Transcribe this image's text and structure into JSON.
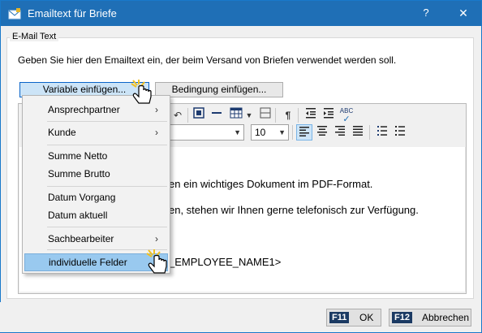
{
  "window": {
    "title": "Emailtext für Briefe",
    "help_symbol": "?",
    "close_symbol": "✕",
    "app_icon": "letter-envelope-icon"
  },
  "group": {
    "label": "E-Mail Text",
    "instruction": "Geben Sie hier den Emailtext ein, der beim Versand von Briefen verwendet werden soll."
  },
  "buttons": {
    "insert_variable": "Variable einfügen...",
    "insert_condition": "Bedingung einfügen..."
  },
  "toolbar": {
    "font_size": "10"
  },
  "document": {
    "lines": [
      "en ein wichtiges Dokument im PDF-Format.",
      "en, stehen wir Ihnen gerne telefonisch zur Verfügung.",
      "_EMPLOYEE_NAME1>"
    ]
  },
  "menu": {
    "items": [
      {
        "label": "Ansprechpartner",
        "submenu": true
      },
      {
        "label": "Kunde",
        "submenu": true
      },
      {
        "label": "Summe Netto",
        "submenu": false
      },
      {
        "label": "Summe Brutto",
        "submenu": false
      },
      {
        "label": "Datum Vorgang",
        "submenu": false
      },
      {
        "label": "Datum aktuell",
        "submenu": false
      },
      {
        "label": "Sachbearbeiter",
        "submenu": true
      },
      {
        "label": "individuelle Felder",
        "submenu": false
      }
    ],
    "submenu_arrow": "›"
  },
  "footer": {
    "ok_key": "F11",
    "ok_label": "OK",
    "cancel_key": "F12",
    "cancel_label": "Abbrechen"
  },
  "colors": {
    "titlebar": "#1f6fb6",
    "menu_highlight": "#99c9ef",
    "key_badge": "#1b3a63"
  }
}
